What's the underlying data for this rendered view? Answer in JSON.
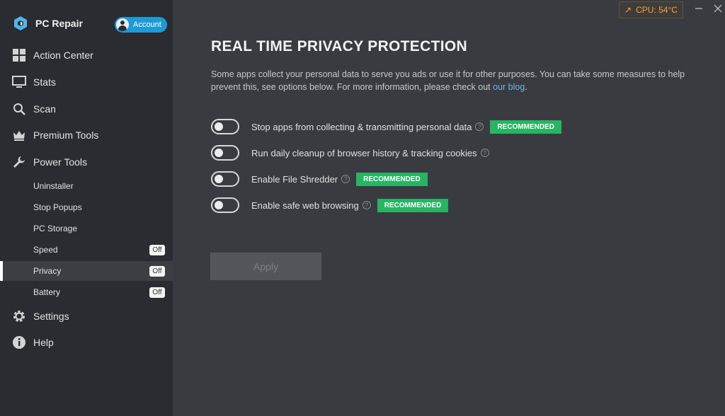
{
  "app": {
    "name": "PC Repair",
    "account_label": "Account"
  },
  "sidebar": {
    "items": [
      {
        "label": "Action Center",
        "icon": "grid-icon"
      },
      {
        "label": "Stats",
        "icon": "monitor-icon"
      },
      {
        "label": "Scan",
        "icon": "search-icon"
      },
      {
        "label": "Premium Tools",
        "icon": "crown-icon"
      },
      {
        "label": "Power Tools",
        "icon": "wrench-icon"
      }
    ],
    "power_tools": [
      {
        "label": "Uninstaller"
      },
      {
        "label": "Stop Popups"
      },
      {
        "label": "PC Storage"
      },
      {
        "label": "Speed",
        "badge": "Off"
      },
      {
        "label": "Privacy",
        "badge": "Off",
        "active": true
      },
      {
        "label": "Battery",
        "badge": "Off"
      }
    ],
    "bottom_items": [
      {
        "label": "Settings",
        "icon": "gear-icon"
      },
      {
        "label": "Help",
        "icon": "info-icon"
      }
    ]
  },
  "titlebar": {
    "cpu_label": "CPU: 54°C",
    "cpu_color": "#f0a43a"
  },
  "main": {
    "title": "REAL TIME PRIVACY PROTECTION",
    "description_text": "Some apps collect your personal data to serve you ads or use it for other purposes. You can take some measures to help prevent this, see options below. For more information, please check out ",
    "description_link": "our blog",
    "description_end": ".",
    "options": [
      {
        "label": "Stop apps from collecting & transmitting personal data",
        "enabled": false,
        "badge": "RECOMMENDED"
      },
      {
        "label": "Run daily cleanup of browser history & tracking cookies",
        "enabled": false,
        "badge": ""
      },
      {
        "label": "Enable File Shredder",
        "enabled": false,
        "badge": "RECOMMENDED"
      },
      {
        "label": "Enable safe web browsing",
        "enabled": false,
        "badge": "RECOMMENDED"
      }
    ],
    "apply_label": "Apply"
  },
  "colors": {
    "sidebar_bg": "#2b2c31",
    "main_bg": "#3a3b41",
    "accent_blue": "#1d9bd6",
    "recommended_green": "#27b463"
  }
}
